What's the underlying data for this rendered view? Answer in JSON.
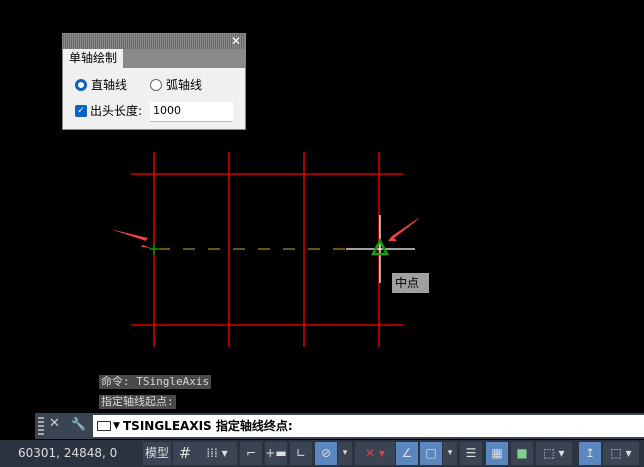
{
  "dialog": {
    "title_close": "✕",
    "tab": "单轴绘制",
    "radio_straight": "直轴线",
    "radio_arc": "弧轴线",
    "selected": "直轴线",
    "checkbox_label": "出头长度:",
    "checkbox_checked": true,
    "length_value": "1000"
  },
  "canvas": {
    "tooltip": "中点",
    "axis_color": "#ff0000",
    "rubber_band_color": "#e0a030",
    "snap_color": "#10a010"
  },
  "history": [
    "命令: TSingleAxis",
    "指定轴线起点:"
  ],
  "command": {
    "close": "✕",
    "wrench": "🔧",
    "prompt": "TSINGLEAXIS 指定轴线终点:"
  },
  "status": {
    "coords": "60301, 24848, 0",
    "model": "模型",
    "grid": "#",
    "snap": "⋮⋮",
    "dropdown": "▾"
  }
}
